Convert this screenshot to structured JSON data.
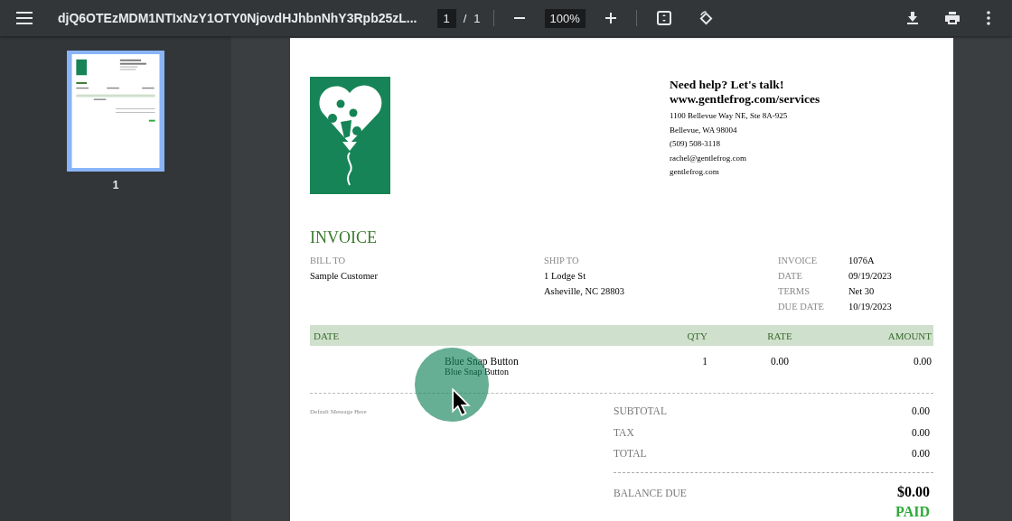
{
  "toolbar": {
    "file_name": "djQ6OTEzMDM1NTIxNzY1OTY0NjovdHJhbnNhY3Rpb25zL...",
    "page_current": "1",
    "page_separator": "/",
    "page_total": "1",
    "zoom": "100%"
  },
  "sidebar": {
    "thumbnails": [
      {
        "label": "1",
        "selected": true
      }
    ]
  },
  "invoice": {
    "contact": {
      "heading": "Need help? Let's talk!",
      "website": "www.gentlefrog.com/services",
      "lines": [
        "1100 Bellevue Way NE, Ste 8A-925",
        "Bellevue, WA  98004",
        "(509) 508-3118",
        "rachel@gentlefrog.com",
        "gentlefrog.com"
      ]
    },
    "title": "INVOICE",
    "bill_to": {
      "label": "BILL TO",
      "lines": [
        "Sample Customer"
      ]
    },
    "ship_to": {
      "label": "SHIP TO",
      "lines": [
        "1 Lodge St",
        "Asheville, NC 28803"
      ]
    },
    "meta": [
      {
        "label": "INVOICE",
        "value": "1076A"
      },
      {
        "label": "DATE",
        "value": "09/19/2023"
      },
      {
        "label": "TERMS",
        "value": "Net 30"
      },
      {
        "label": "DUE DATE",
        "value": "10/19/2023"
      }
    ],
    "table": {
      "columns": [
        "DATE",
        "QTY",
        "RATE",
        "AMOUNT"
      ],
      "rows": [
        {
          "item": "Blue Snap Button",
          "description": "Blue Snap Button",
          "qty": "1",
          "rate": "0.00",
          "amount": "0.00"
        }
      ]
    },
    "message": "Default Message Here",
    "totals": [
      {
        "label": "SUBTOTAL",
        "value": "0.00"
      },
      {
        "label": "TAX",
        "value": "0.00"
      },
      {
        "label": "TOTAL",
        "value": "0.00"
      }
    ],
    "balance": {
      "label": "BALANCE DUE",
      "value": "$0.00"
    },
    "status": "PAID"
  }
}
